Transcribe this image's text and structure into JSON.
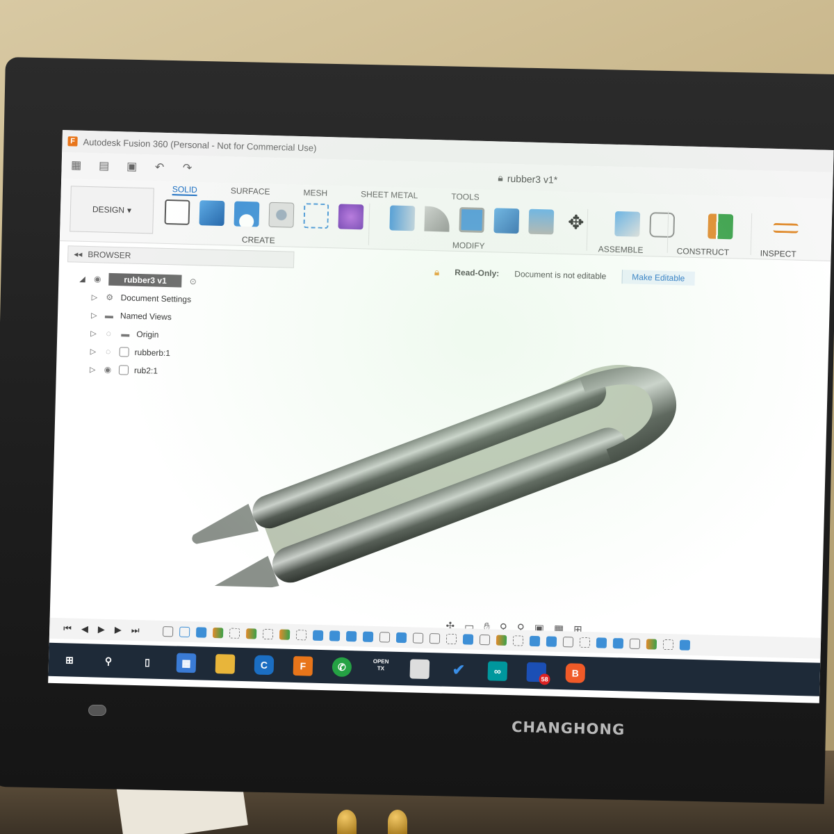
{
  "window": {
    "title": "Autodesk Fusion 360 (Personal - Not for Commercial Use)"
  },
  "document": {
    "name": "rubber3 v1*"
  },
  "workspace": {
    "label": "DESIGN"
  },
  "ribbon": {
    "tabs": [
      "SOLID",
      "SURFACE",
      "MESH",
      "SHEET METAL",
      "TOOLS"
    ],
    "active_tab": "SOLID",
    "groups": {
      "create": "CREATE",
      "modify": "MODIFY",
      "assemble": "ASSEMBLE",
      "construct": "CONSTRUCT",
      "inspect": "INSPECT"
    }
  },
  "browser": {
    "header": "BROWSER",
    "root": "rubber3 v1",
    "items": [
      "Document Settings",
      "Named Views",
      "Origin",
      "rubberb:1",
      "rub2:1"
    ]
  },
  "banner": {
    "label": "Read-Only:",
    "message": "Document is not editable",
    "action": "Make Editable"
  },
  "taskbar": {
    "apps": [
      "start",
      "search",
      "task-view",
      "store",
      "file-explorer",
      "cortana",
      "fusion-360",
      "whatsapp",
      "opentx",
      "photos",
      "todo",
      "arduino",
      "outlook",
      "brave"
    ],
    "outlook_badge": "58",
    "opentx_label": "OPEN TX"
  },
  "monitor": {
    "brand": "CHANGHONG"
  }
}
